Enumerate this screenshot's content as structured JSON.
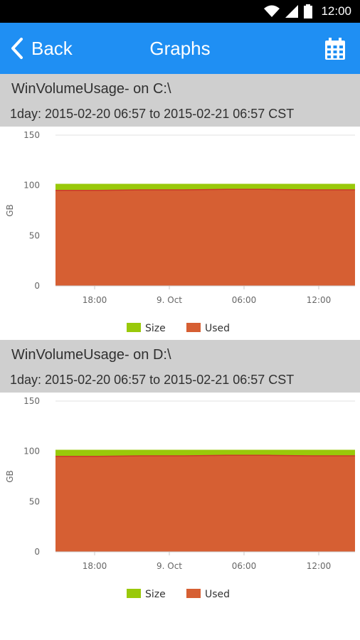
{
  "status_bar": {
    "time": "12:00"
  },
  "app_bar": {
    "back_label": "Back",
    "title": "Graphs",
    "calendar_icon": "calendar-icon"
  },
  "colors": {
    "app_bar": "#1f8ff3",
    "size_series": "#99c90a",
    "used_series": "#d65f33",
    "header_bg": "#cfcfcf"
  },
  "graphs": [
    {
      "title": "WinVolumeUsage- on C:\\",
      "range": "1day: 2015-02-20 06:57 to 2015-02-21 06:57 CST"
    },
    {
      "title": "WinVolumeUsage- on D:\\",
      "range": "1day: 2015-02-20 06:57 to 2015-02-21 06:57 CST"
    }
  ],
  "chart_data": [
    {
      "type": "area",
      "title": "",
      "xlabel": "",
      "ylabel": "GB",
      "ylim": [
        0,
        150
      ],
      "yticks": [
        0,
        50,
        100,
        150
      ],
      "x_tick_labels": [
        "18:00",
        "9. Oct",
        "06:00",
        "12:00"
      ],
      "legend": "bottom-center",
      "grid": true,
      "series": [
        {
          "name": "Size",
          "color": "#99c90a",
          "values": [
            101,
            101,
            101,
            101,
            101,
            101,
            101,
            101
          ]
        },
        {
          "name": "Used",
          "color": "#d65f33",
          "values": [
            95,
            95,
            95.5,
            95.5,
            96,
            96,
            95.5,
            95.5
          ]
        }
      ]
    },
    {
      "type": "area",
      "title": "",
      "xlabel": "",
      "ylabel": "GB",
      "ylim": [
        0,
        150
      ],
      "yticks": [
        0,
        50,
        100,
        150
      ],
      "x_tick_labels": [
        "18:00",
        "9. Oct",
        "06:00",
        "12:00"
      ],
      "legend": "bottom-center",
      "grid": true,
      "series": [
        {
          "name": "Size",
          "color": "#99c90a",
          "values": [
            101,
            101,
            101,
            101,
            101,
            101,
            101,
            101
          ]
        },
        {
          "name": "Used",
          "color": "#d65f33",
          "values": [
            95,
            95,
            95.5,
            95.5,
            96,
            96,
            95.5,
            95.5
          ]
        }
      ]
    }
  ]
}
